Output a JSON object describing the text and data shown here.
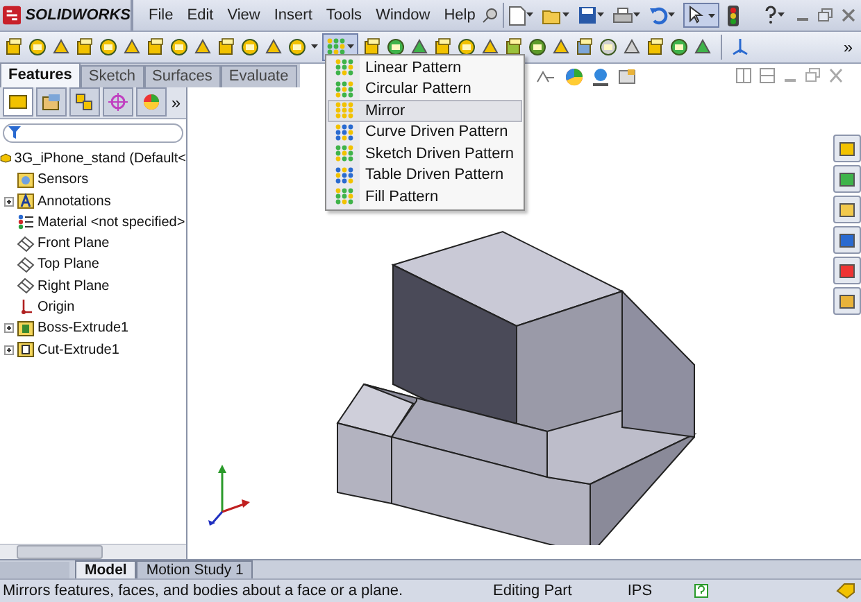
{
  "app": {
    "logo": "SOLIDWORKS"
  },
  "menu": [
    "File",
    "Edit",
    "View",
    "Insert",
    "Tools",
    "Window",
    "Help"
  ],
  "toolbar": {
    "pattern_menu_open": true,
    "overflow": "»"
  },
  "command_tabs": [
    {
      "label": "Features",
      "selected": true
    },
    {
      "label": "Sketch",
      "selected": false
    },
    {
      "label": "Surfaces",
      "selected": false
    },
    {
      "label": "Evaluate",
      "selected": false
    }
  ],
  "panel_tabs": [
    {
      "selected": true
    },
    {
      "selected": false
    },
    {
      "selected": false
    },
    {
      "selected": false
    },
    {
      "selected": false
    }
  ],
  "panel_overflow": "»",
  "tree": {
    "root": "3G_iPhone_stand  (Default<",
    "children": [
      {
        "label": "Sensors",
        "kind": "sensor",
        "expander": false
      },
      {
        "label": "Annotations",
        "kind": "annotation",
        "expander": true
      },
      {
        "label": "Material <not specified>",
        "kind": "material",
        "expander": false
      },
      {
        "label": "Front Plane",
        "kind": "plane",
        "expander": false
      },
      {
        "label": "Top Plane",
        "kind": "plane",
        "expander": false
      },
      {
        "label": "Right Plane",
        "kind": "plane",
        "expander": false
      },
      {
        "label": "Origin",
        "kind": "origin",
        "expander": false
      },
      {
        "label": "Boss-Extrude1",
        "kind": "boss",
        "expander": true
      },
      {
        "label": "Cut-Extrude1",
        "kind": "cut",
        "expander": true
      }
    ]
  },
  "dropdown": {
    "items": [
      {
        "label": "Linear Pattern",
        "selected": false
      },
      {
        "label": "Circular Pattern",
        "selected": false
      },
      {
        "label": "Mirror",
        "selected": true
      },
      {
        "label": "Curve Driven Pattern",
        "selected": false
      },
      {
        "label": "Sketch Driven Pattern",
        "selected": false
      },
      {
        "label": "Table Driven Pattern",
        "selected": false
      },
      {
        "label": "Fill Pattern",
        "selected": false
      }
    ]
  },
  "bottom_tabs": [
    {
      "label": "Model",
      "selected": true
    },
    {
      "label": "Motion Study 1",
      "selected": false
    }
  ],
  "status_bar": {
    "message": "Mirrors features, faces, and bodies about a face or a plane.",
    "mode": "Editing Part",
    "units": "IPS"
  }
}
